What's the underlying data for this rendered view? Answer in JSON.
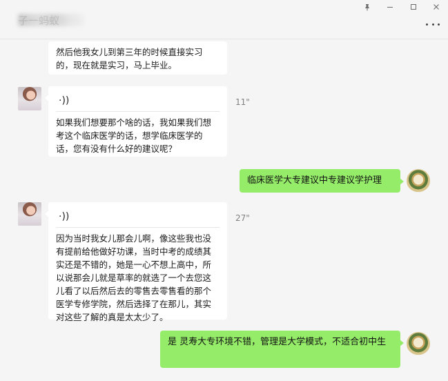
{
  "header": {
    "chat_title": "子一蚂蚁",
    "window_buttons": {
      "pin_icon": "pin-icon",
      "minimize_icon": "minimize-icon",
      "maximize_icon": "maximize-icon",
      "close_icon": "close-icon"
    },
    "more_icon": "more-dots-icon"
  },
  "messages": [
    {
      "side": "left",
      "type": "text",
      "text": "然后他我女儿到第三年的时候直接实习的，现在就是实习，马上毕业。"
    },
    {
      "side": "left",
      "type": "voice",
      "voice_symbol": "·))",
      "duration": "11\"",
      "transcript": "如果我们想要那个啥的话，我如果我们想考这个临床医学的话，想学临床医学的话，您有没有什么好的建议呢？"
    },
    {
      "side": "right",
      "type": "text",
      "text": "临床医学大专建议中专建议学护理"
    },
    {
      "side": "left",
      "type": "voice",
      "voice_symbol": "·))",
      "duration": "27\"",
      "transcript": "因为当时我女儿那会儿啊，像这些我也没有提前给他做好功课，当时中考的成绩其实还是不错的，她是一心不想上高中，所以说那会儿就是草率的就选了一个去您这儿看了以后然后去的零售去零售看的那个医学专修学院，然后选择了在那儿，其实对这些了解的真是太太少了。"
    },
    {
      "side": "right",
      "type": "text",
      "text": "是 灵寿大专环境不错，管理是大学模式，不适合初中生"
    }
  ],
  "colors": {
    "background": "#f5f5f5",
    "incoming_bubble": "#ffffff",
    "outgoing_bubble": "#95ec69",
    "duration_text": "#7f7f7f"
  }
}
